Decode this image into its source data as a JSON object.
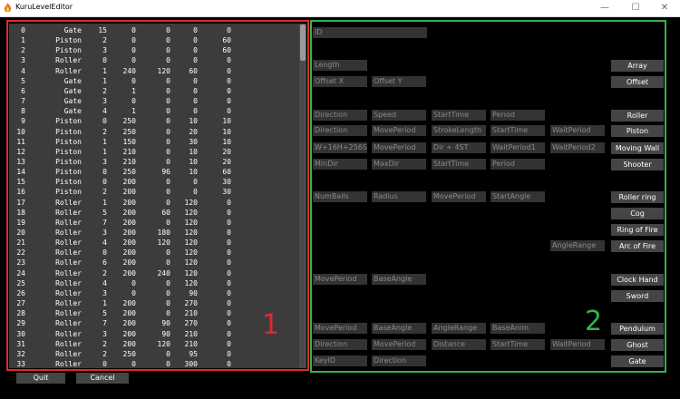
{
  "window": {
    "title": "KuruLevelEditor",
    "controls": [
      "—",
      "☐",
      "✕"
    ]
  },
  "list": {
    "rows": [
      [
        "0",
        "Gate",
        "15",
        "0",
        "0",
        "0",
        "0"
      ],
      [
        "1",
        "Piston",
        "2",
        "0",
        "0",
        "0",
        "60"
      ],
      [
        "2",
        "Piston",
        "3",
        "0",
        "0",
        "0",
        "60"
      ],
      [
        "3",
        "Roller",
        "0",
        "0",
        "0",
        "0",
        "0"
      ],
      [
        "4",
        "Roller",
        "1",
        "240",
        "120",
        "60",
        "0"
      ],
      [
        "5",
        "Gate",
        "1",
        "0",
        "0",
        "0",
        "0"
      ],
      [
        "6",
        "Gate",
        "2",
        "1",
        "0",
        "0",
        "0"
      ],
      [
        "7",
        "Gate",
        "3",
        "0",
        "0",
        "0",
        "0"
      ],
      [
        "8",
        "Gate",
        "4",
        "1",
        "0",
        "0",
        "0"
      ],
      [
        "9",
        "Piston",
        "0",
        "250",
        "0",
        "10",
        "10"
      ],
      [
        "10",
        "Piston",
        "2",
        "250",
        "0",
        "20",
        "10"
      ],
      [
        "11",
        "Piston",
        "1",
        "150",
        "0",
        "30",
        "10"
      ],
      [
        "12",
        "Piston",
        "1",
        "210",
        "0",
        "10",
        "20"
      ],
      [
        "13",
        "Piston",
        "3",
        "210",
        "0",
        "10",
        "20"
      ],
      [
        "14",
        "Piston",
        "0",
        "250",
        "96",
        "10",
        "60"
      ],
      [
        "15",
        "Piston",
        "0",
        "200",
        "0",
        "0",
        "30"
      ],
      [
        "16",
        "Piston",
        "2",
        "200",
        "0",
        "0",
        "30"
      ],
      [
        "17",
        "Roller",
        "1",
        "200",
        "0",
        "120",
        "0"
      ],
      [
        "18",
        "Roller",
        "5",
        "200",
        "60",
        "120",
        "0"
      ],
      [
        "19",
        "Roller",
        "7",
        "200",
        "0",
        "120",
        "0"
      ],
      [
        "20",
        "Roller",
        "3",
        "200",
        "180",
        "120",
        "0"
      ],
      [
        "21",
        "Roller",
        "4",
        "200",
        "120",
        "120",
        "0"
      ],
      [
        "22",
        "Roller",
        "0",
        "200",
        "0",
        "120",
        "0"
      ],
      [
        "23",
        "Roller",
        "6",
        "200",
        "0",
        "120",
        "0"
      ],
      [
        "24",
        "Roller",
        "2",
        "200",
        "240",
        "120",
        "0"
      ],
      [
        "25",
        "Roller",
        "4",
        "0",
        "0",
        "120",
        "0"
      ],
      [
        "26",
        "Roller",
        "3",
        "0",
        "0",
        "90",
        "0"
      ],
      [
        "27",
        "Roller",
        "1",
        "200",
        "0",
        "270",
        "0"
      ],
      [
        "28",
        "Roller",
        "5",
        "200",
        "0",
        "210",
        "0"
      ],
      [
        "29",
        "Roller",
        "7",
        "200",
        "90",
        "270",
        "0"
      ],
      [
        "30",
        "Roller",
        "3",
        "200",
        "90",
        "210",
        "0"
      ],
      [
        "31",
        "Roller",
        "2",
        "200",
        "120",
        "210",
        "0"
      ],
      [
        "32",
        "Roller",
        "2",
        "250",
        "0",
        "95",
        "0"
      ],
      [
        "33",
        "Roller",
        "0",
        "0",
        "0",
        "300",
        "0"
      ]
    ]
  },
  "buttons": {
    "quit": "Quit",
    "cancel": "Cancel"
  },
  "fields": {
    "id": "ID",
    "length": "Length",
    "offset_x": "Offset X",
    "offset_y": "Offset Y",
    "r1": [
      "Direction",
      "Speed",
      "StartTime",
      "Period"
    ],
    "r2": [
      "Direction",
      "MovePeriod",
      "StrokeLength",
      "StartTime",
      "WaitPeriod"
    ],
    "r3": [
      "W+16H+256SL",
      "MovePeriod",
      "Dir + 4ST",
      "WaitPeriod1",
      "WaitPeriod2"
    ],
    "r4": [
      "MinDir",
      "MaxDir",
      "StartTime",
      "Period"
    ],
    "r5": [
      "NumBalls",
      "Radius",
      "MovePeriod",
      "StartAngle"
    ],
    "angle_range": "AngleRange",
    "r6": [
      "MovePeriod",
      "BaseAngle"
    ],
    "r7": [
      "MovePeriod",
      "BaseAngle",
      "AngleRange",
      "BaseAnim"
    ],
    "r8": [
      "Direction",
      "MovePeriod",
      "Distance",
      "StartTime",
      "WaitPeriod"
    ],
    "r9": [
      "KeyID",
      "Direction"
    ]
  },
  "types": [
    "Array",
    "Offset",
    "Roller",
    "Piston",
    "Moving Wall",
    "Shooter",
    "Roller ring",
    "Cog",
    "Ring of Fire",
    "Arc of Fire",
    "Clock Hand",
    "Sword",
    "Pendulum",
    "Ghost",
    "Gate"
  ],
  "annotations": {
    "red_label": "1",
    "green_label": "2",
    "red_color": "#e02a2a",
    "green_color": "#34b34a"
  }
}
